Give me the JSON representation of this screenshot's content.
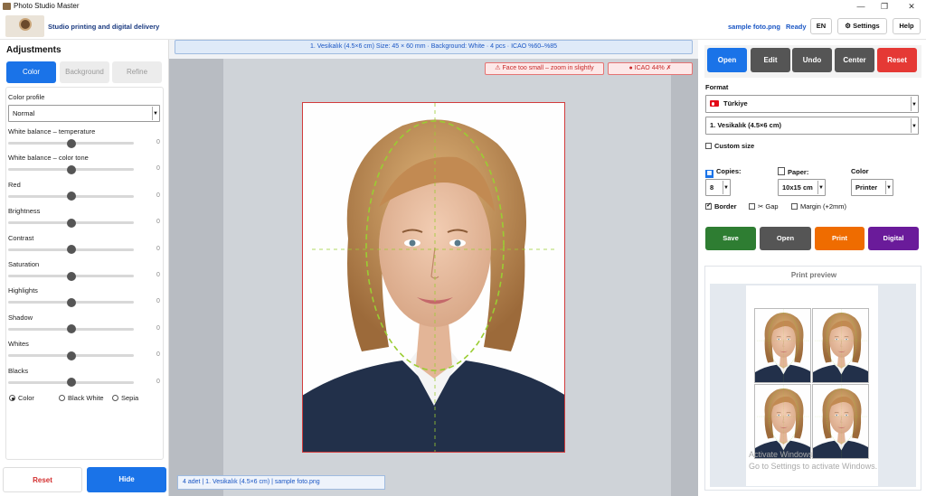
{
  "window": {
    "title": "Photo Studio Master"
  },
  "header": {
    "tagline": "Studio printing and digital delivery",
    "file_name": "sample foto.png",
    "status": "Ready",
    "lang": "EN",
    "settings": "Settings",
    "help": "Help"
  },
  "left": {
    "title": "Adjustments",
    "tabs": [
      "Color",
      "Background",
      "Refine"
    ],
    "color_profile_label": "Color profile",
    "color_profile_value": "Normal",
    "sliders": [
      {
        "label": "White balance – temperature",
        "value": 0
      },
      {
        "label": "White balance – color tone",
        "value": 0
      },
      {
        "label": "Red",
        "value": 0
      },
      {
        "label": "Brightness",
        "value": 0
      },
      {
        "label": "Contrast",
        "value": 0
      },
      {
        "label": "Saturation",
        "value": 0
      },
      {
        "label": "Highlights",
        "value": 0
      },
      {
        "label": "Shadow",
        "value": 0
      },
      {
        "label": "Whites",
        "value": 0
      },
      {
        "label": "Blacks",
        "value": 0
      }
    ],
    "modes": [
      "Color",
      "Black White",
      "Sepia"
    ],
    "reset": "Reset",
    "hide": "Hide"
  },
  "center": {
    "info": "1. Vesikalık (4.5×6 cm) Size: 45 × 60 mm · Background: White · 4 pcs · ICAO %60–%85",
    "warn_small": "Face too small – zoom in slightly",
    "warn_icao": "ICAO 44%",
    "footer": "4 adet | 1. Vesikalık (4.5×6 cm) | sample foto.png"
  },
  "right": {
    "toolbar": [
      "Open",
      "Edit",
      "Undo",
      "Center",
      "Reset"
    ],
    "format_label": "Format",
    "country": "Türkiye",
    "format_value": "1. Vesikalık (4.5×6 cm)",
    "custom_size": "Custom size",
    "copies_label": "Copies:",
    "copies_value": "8",
    "paper_label": "Paper:",
    "paper_value": "10x15 cm",
    "color_label": "Color",
    "color_value": "Printer",
    "border": "Border",
    "gap": "Gap",
    "margin": "Margin (+2mm)",
    "actions": [
      "Save",
      "Open",
      "Print",
      "Digital"
    ],
    "preview_title": "Print preview"
  },
  "watermark": {
    "line1": "Activate Windows",
    "line2": "Go to Settings to activate Windows."
  },
  "colors": {
    "accent": "#1a73e8",
    "danger": "#e53935",
    "success": "#2e7d32",
    "orange": "#ef6c00",
    "purple": "#6a1b9a"
  }
}
